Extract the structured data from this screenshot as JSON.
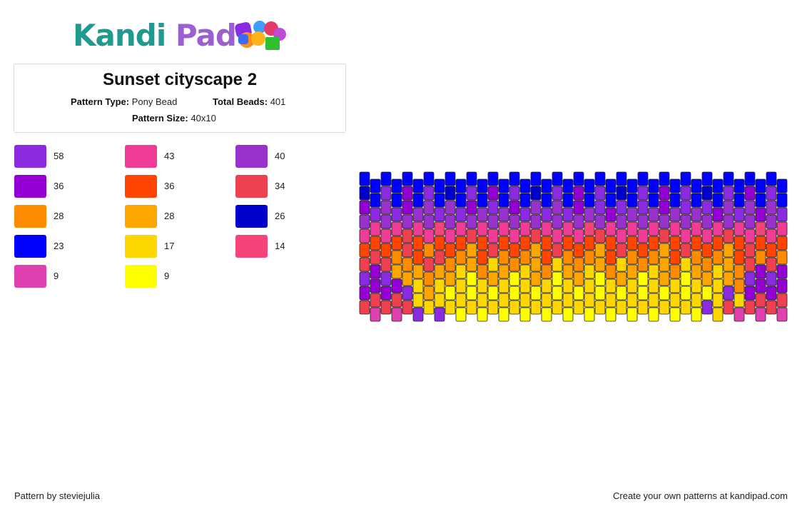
{
  "brand": {
    "logo_text_1": "Kandi",
    "logo_text_2": "Pad",
    "logo_icon": "bead-pile-icon",
    "colors": {
      "teal": "#1f9a8f",
      "purple": "#9b5fd1"
    }
  },
  "pattern_info": {
    "title": "Sunset cityscape 2",
    "type_label": "Pattern Type:",
    "type_value": "Pony Bead",
    "beads_label": "Total Beads:",
    "beads_value": "401",
    "size_label": "Pattern Size:",
    "size_value": "40x10"
  },
  "legend": [
    {
      "color": "#8a2be2",
      "count": "58"
    },
    {
      "color": "#f03c96",
      "count": "43"
    },
    {
      "color": "#9932cc",
      "count": "40"
    },
    {
      "color": "#9400d3",
      "count": "36"
    },
    {
      "color": "#ff4500",
      "count": "36"
    },
    {
      "color": "#ef4050",
      "count": "34"
    },
    {
      "color": "#ff8c00",
      "count": "28"
    },
    {
      "color": "#ffa500",
      "count": "28"
    },
    {
      "color": "#0000cd",
      "count": "26"
    },
    {
      "color": "#0000ff",
      "count": "23"
    },
    {
      "color": "#ffd700",
      "count": "17"
    },
    {
      "color": "#f4447a",
      "count": "14"
    },
    {
      "color": "#e040b0",
      "count": "9"
    },
    {
      "color": "#ffff00",
      "count": "9"
    }
  ],
  "bead_pattern": {
    "columns": 40,
    "rows": 10,
    "grid": [
      "JJJJJJJJJJJJJJJJJJJJJJJJJJJJJJJJJJJJJJJJ",
      "IJAJCJAJIJAJCJAJIJAJCJAJIJAJCJAJIJAJCJAJ",
      "CABACBBABACBABCABABACBACABABCBABACBABCBA",
      "BFBFBFBLBFBFBFBFBFBFBLBFBFBFBFBFBFBFBLBF",
      "FEFEDEFEFEDEFEFEDEFEFEDEFEFEDEFEFEDEFEFE",
      "EDEGDEGDEGHEDGEGHEDGEGHEDGEGHEDGEGHEDGEG",
      "DCDHGHDHGKHGKHGKHGKHGKHGKHGKHGKHGKHGDCDC",
      "ACACHKGKHKNKHKNKHKNKHKNKHKNKHKNKHKHGACAC",
      "CDCDAKHKNKNKNKNKNKNKNKNKNKNKNKNKNKAKCDCD",
      "DMDMDAKAKNKNKNKNKNKNKNKNKNKNKNKNAKDMDMDM"
    ]
  },
  "footer": {
    "author_text": "Pattern by steviejulia",
    "promo_text": "Create your own patterns at kandipad.com"
  }
}
